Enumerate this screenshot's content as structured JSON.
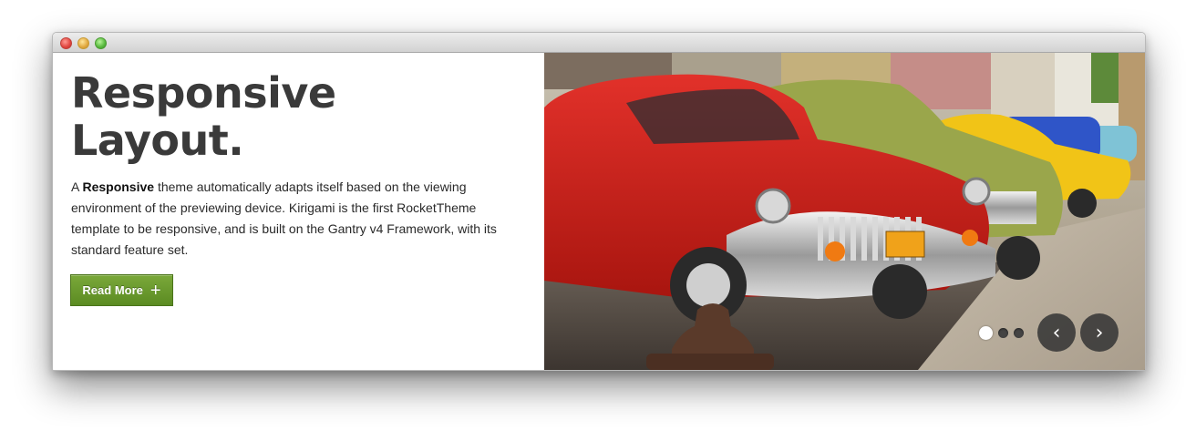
{
  "window": {
    "controls": [
      "close",
      "minimize",
      "maximize"
    ]
  },
  "hero": {
    "headline_line1": "Responsive",
    "headline_line2": "Layout.",
    "body_prefix": "A ",
    "body_bold": "Responsive",
    "body_rest": " theme automatically adapts itself based on the viewing environment of the previewing device. Kirigami is the first RocketTheme template to be responsive, and is built on the Gantry v4 Framework, with its standard feature set.",
    "button_label": "Read More",
    "button_icon": "plus-icon",
    "accent_color": "#6a9a2c"
  },
  "slideshow": {
    "image_description": "classic cars parked on a street",
    "slide_count": 3,
    "active_slide": 1,
    "prev_icon": "chevron-left-icon",
    "next_icon": "chevron-right-icon",
    "prev_glyph": "‹",
    "next_glyph": "›"
  }
}
